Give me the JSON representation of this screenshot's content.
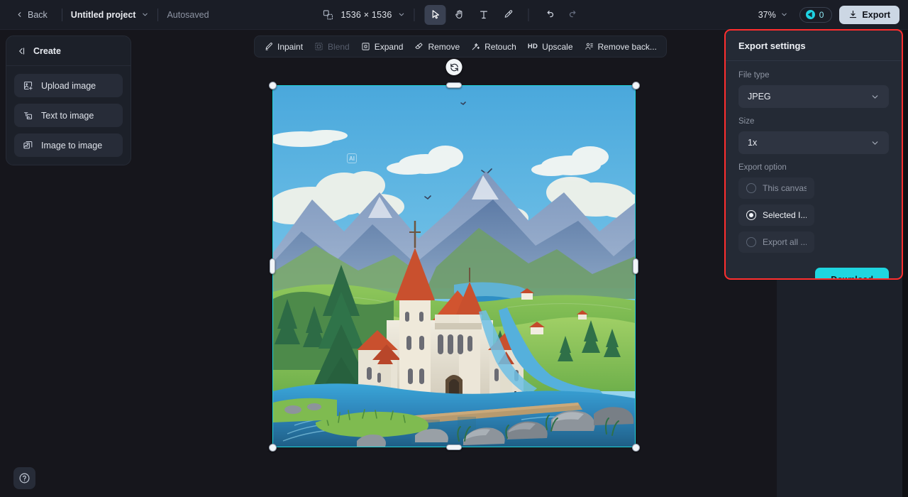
{
  "topbar": {
    "back_label": "Back",
    "project_name": "Untitled project",
    "autosaved_label": "Autosaved",
    "canvas_size": "1536 × 1536",
    "canvas_icon": "canvas-resize-icon",
    "tools": [
      {
        "name": "select-tool",
        "icon": "cursor-arrow-icon",
        "active": true
      },
      {
        "name": "hand-tool",
        "icon": "hand-icon",
        "active": false
      },
      {
        "name": "text-tool",
        "icon": "text-t-icon",
        "active": false
      },
      {
        "name": "brush-tool",
        "icon": "brush-icon",
        "active": false
      }
    ],
    "history": [
      {
        "name": "undo-button",
        "icon": "undo-arrow-icon",
        "disabled": false
      },
      {
        "name": "redo-button",
        "icon": "redo-arrow-icon",
        "disabled": true
      }
    ],
    "zoom_level": "37%",
    "credits_count": "0",
    "credits_icon": "credit-coin-icon",
    "export_label": "Export",
    "export_icon": "download-icon"
  },
  "create_panel": {
    "title": "Create",
    "collapse_icon": "collapse-panel-icon",
    "items": [
      {
        "label": "Upload image",
        "icon": "image-upload-icon"
      },
      {
        "label": "Text to image",
        "icon": "text-to-image-icon"
      },
      {
        "label": "Image to image",
        "icon": "image-to-image-icon"
      }
    ]
  },
  "image_toolbar": {
    "items": [
      {
        "label": "Inpaint",
        "icon": "inpaint-brush-icon",
        "disabled": false
      },
      {
        "label": "Blend",
        "icon": "blend-icon",
        "disabled": true
      },
      {
        "label": "Expand",
        "icon": "expand-frame-icon",
        "disabled": false
      },
      {
        "label": "Remove",
        "icon": "eraser-icon",
        "disabled": false
      },
      {
        "label": "Retouch",
        "icon": "magic-wand-icon",
        "disabled": false
      },
      {
        "label": "Upscale",
        "icon": "hd-icon",
        "disabled": false,
        "badge": "HD"
      },
      {
        "label": "Remove back...",
        "icon": "remove-background-icon",
        "disabled": false
      }
    ]
  },
  "canvas": {
    "selection_color": "#1ed3d8",
    "rotate_icon": "rotate-icon",
    "ai_tag": "AI",
    "artwork_description": "Illustration of a gothic castle with red roofs beside a winding river, green hills, pine trees and blue mountains under a cloudy sky"
  },
  "export_settings": {
    "title": "Export settings",
    "highlight_color": "#ff2e2e",
    "file_type": {
      "label": "File type",
      "value": "JPEG",
      "chevron": "chevron-down-icon"
    },
    "size": {
      "label": "Size",
      "value": "1x",
      "chevron": "chevron-down-icon"
    },
    "export_option": {
      "label": "Export option",
      "options": [
        {
          "label": "This canvas",
          "selected": false
        },
        {
          "label": "Selected I...",
          "selected": true
        },
        {
          "label": "Export all ...",
          "selected": false
        }
      ]
    },
    "download_label": "Download",
    "download_color": "#1fd6e0"
  },
  "help": {
    "icon": "help-question-icon"
  }
}
